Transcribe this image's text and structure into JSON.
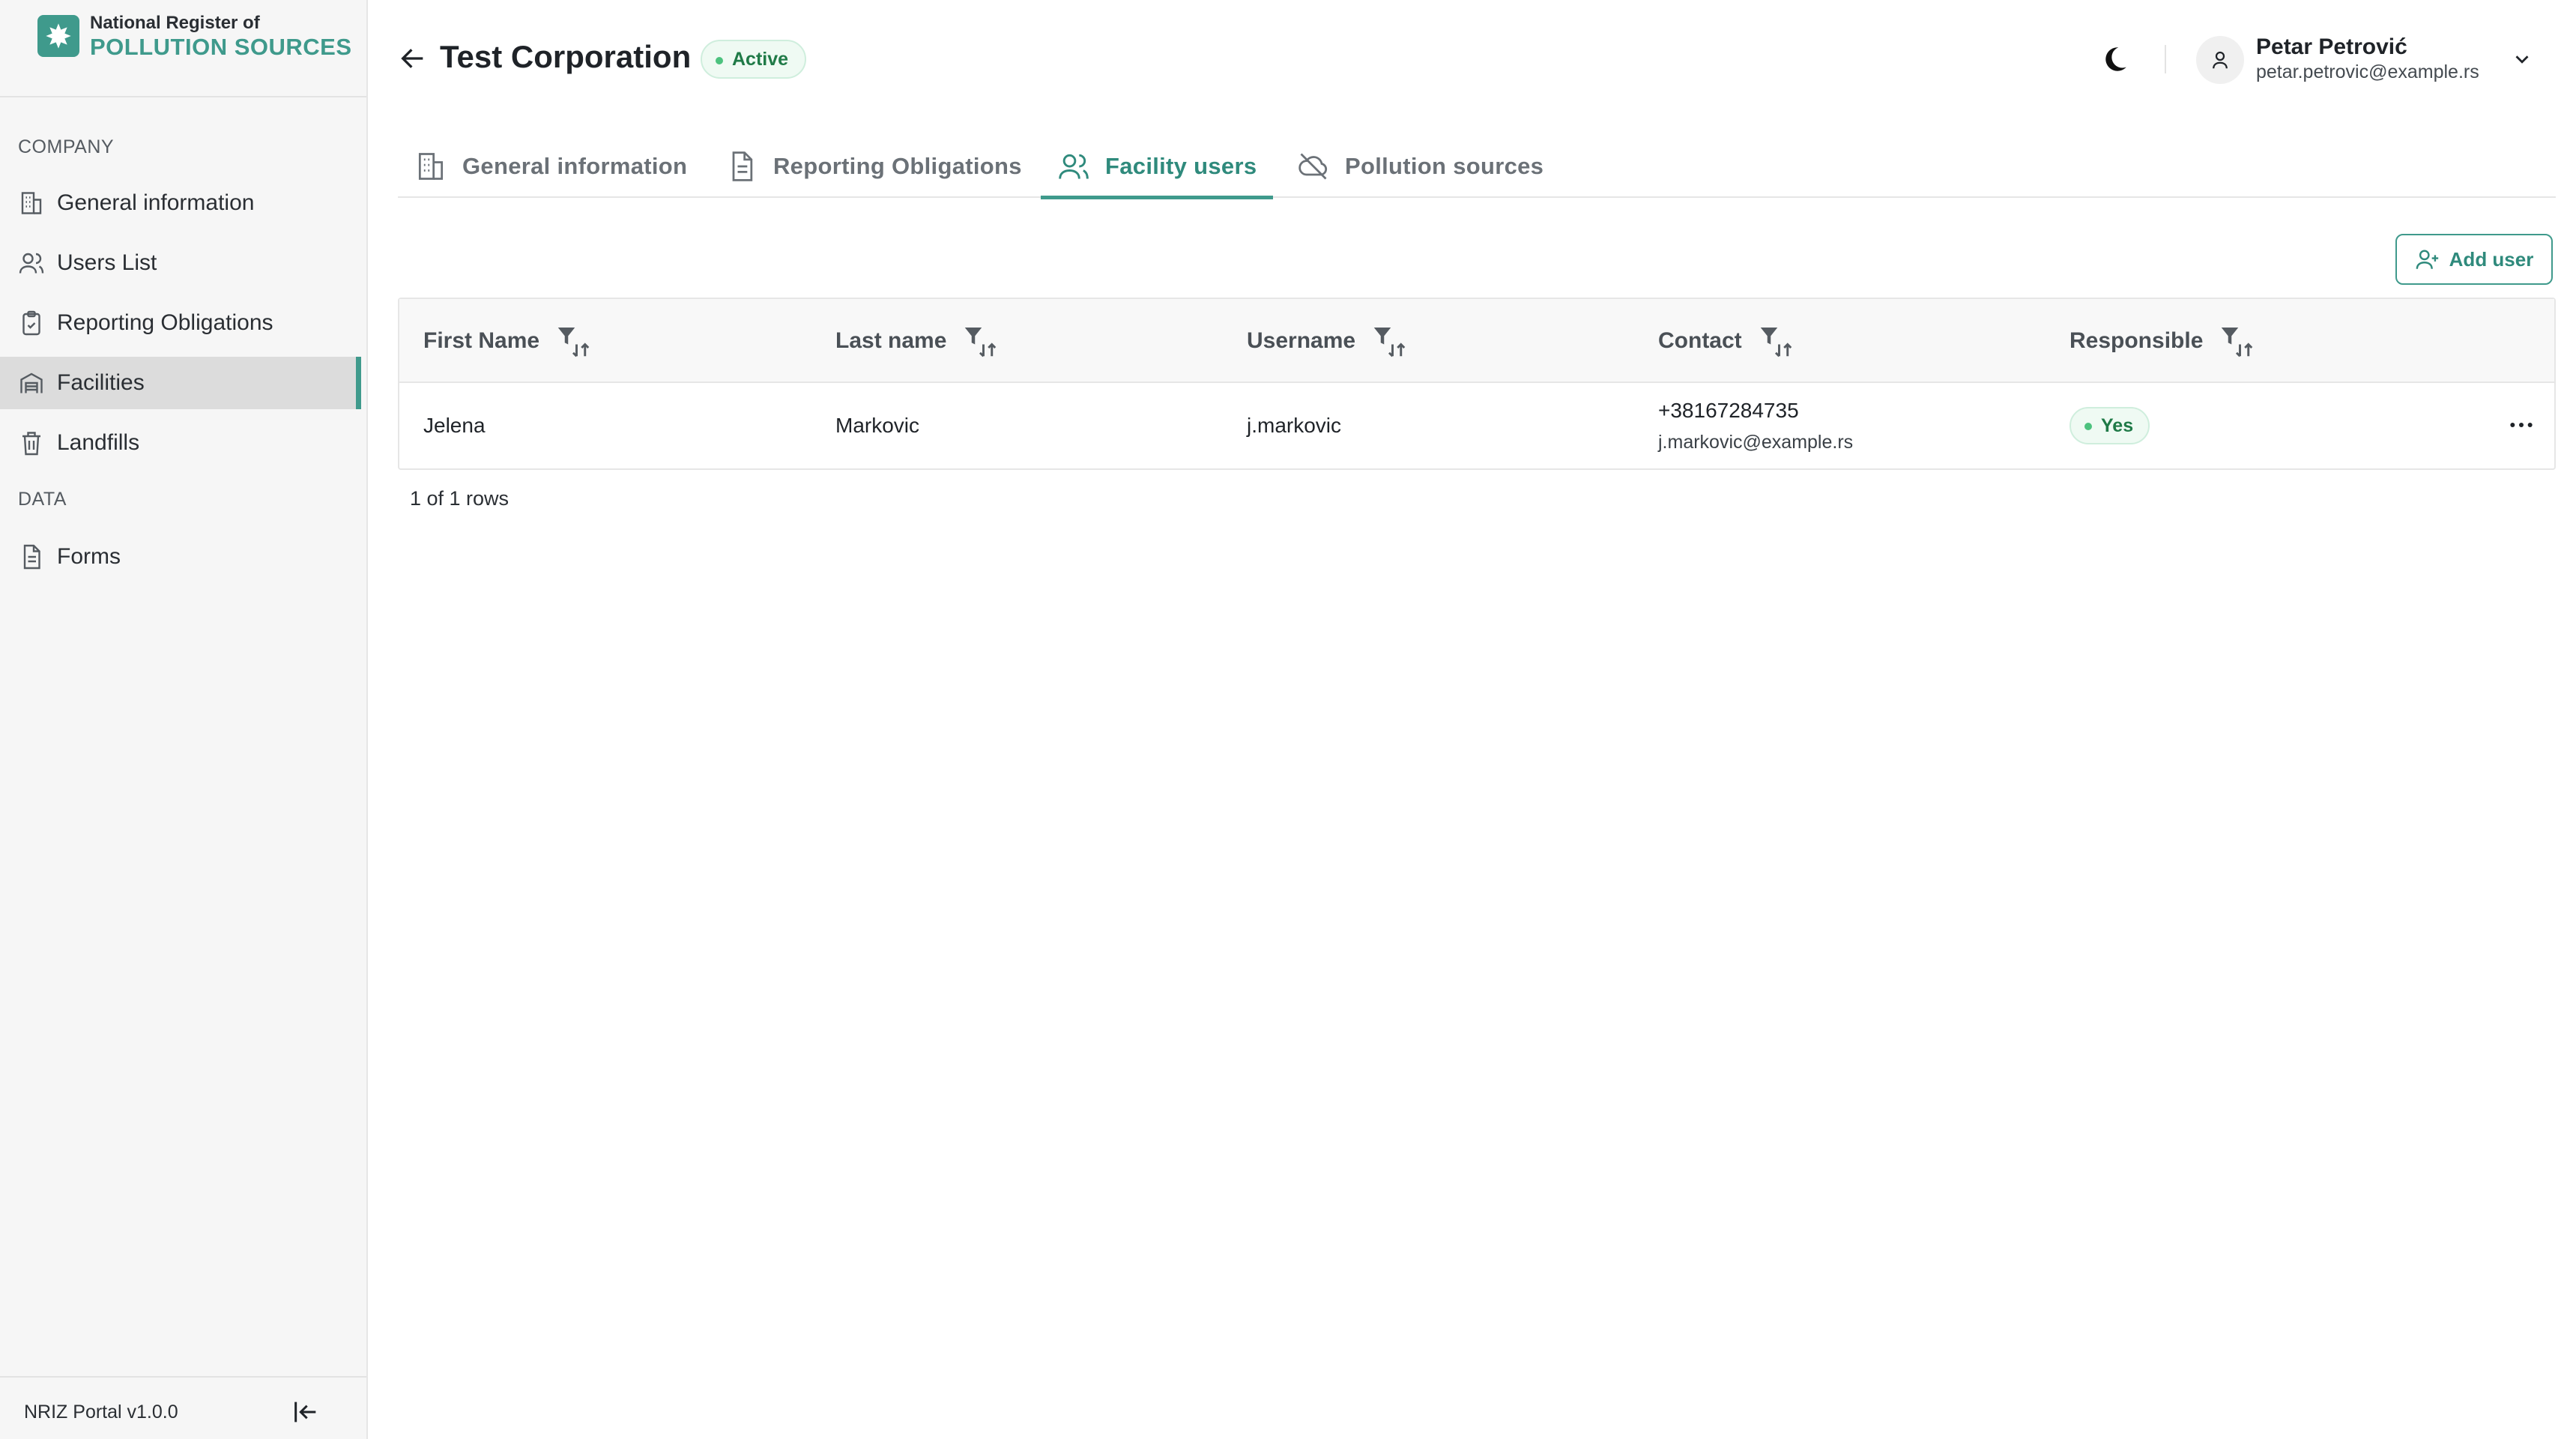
{
  "brand": {
    "line1": "National Register of",
    "line2": "POLLUTION SOURCES"
  },
  "sidebar": {
    "sections": [
      {
        "title": "COMPANY"
      },
      {
        "title": "DATA"
      }
    ],
    "items": [
      {
        "label": "General information",
        "icon": "building-icon"
      },
      {
        "label": "Users List",
        "icon": "users-icon"
      },
      {
        "label": "Reporting Obligations",
        "icon": "clipboard-check-icon"
      },
      {
        "label": "Facilities",
        "icon": "warehouse-icon",
        "active": true
      },
      {
        "label": "Landfills",
        "icon": "trash-icon"
      },
      {
        "label": "Forms",
        "icon": "document-icon"
      }
    ],
    "version": "NRIZ Portal v1.0.0"
  },
  "header": {
    "title": "Test Corporation",
    "status": "Active",
    "user": {
      "name": "Petar Petrović",
      "email": "petar.petrovic@example.rs"
    }
  },
  "tabs": [
    {
      "label": "General information",
      "icon": "building-icon"
    },
    {
      "label": "Reporting Obligations",
      "icon": "document-icon"
    },
    {
      "label": "Facility users",
      "icon": "users-icon",
      "active": true
    },
    {
      "label": "Pollution sources",
      "icon": "cloud-off-icon"
    }
  ],
  "toolbar": {
    "add_user_label": "Add user"
  },
  "table": {
    "columns": [
      "First Name",
      "Last name",
      "Username",
      "Contact",
      "Responsible"
    ],
    "rows": [
      {
        "first_name": "Jelena",
        "last_name": "Markovic",
        "username": "j.markovic",
        "phone": "+38167284735",
        "email": "j.markovic@example.rs",
        "responsible": "Yes"
      }
    ],
    "footer": "1 of 1 rows"
  },
  "colors": {
    "accent": "#3f9a8c",
    "success_bg": "#effaf3",
    "success_text": "#1f7a47"
  }
}
